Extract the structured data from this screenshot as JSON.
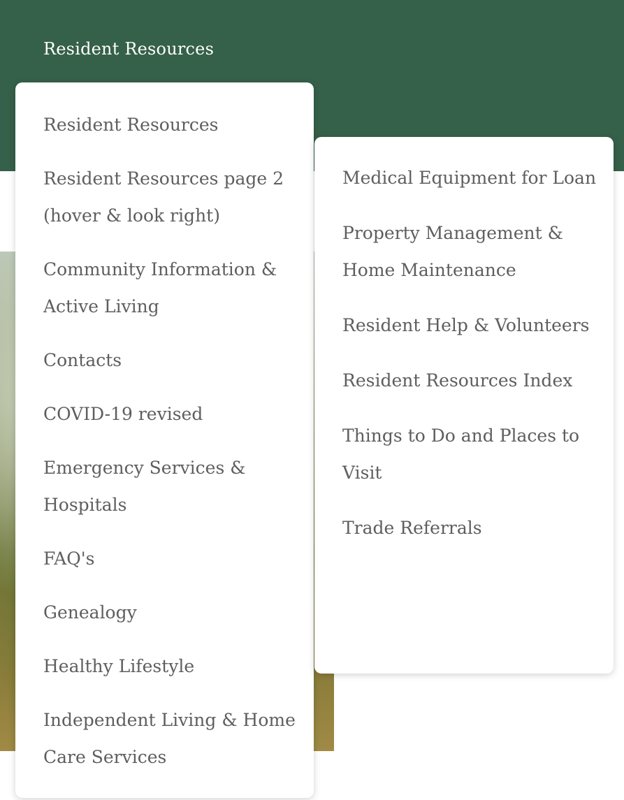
{
  "header": {
    "nav_title": "Resident Resources"
  },
  "colors": {
    "header_green": "#356049",
    "menu_text": "#5e5e5e",
    "menu_bg": "#ffffff"
  },
  "primary_menu": {
    "items": [
      {
        "label": "Resident Resources"
      },
      {
        "label": "Resident Resources page 2 (hover & look right)"
      },
      {
        "label": "Community Information & Active Living"
      },
      {
        "label": "Contacts"
      },
      {
        "label": "COVID-19 revised"
      },
      {
        "label": "Emergency Services & Hospitals"
      },
      {
        "label": "FAQ's"
      },
      {
        "label": "Genealogy"
      },
      {
        "label": "Healthy Lifestyle"
      },
      {
        "label": "Independent Living & Home Care Services"
      }
    ]
  },
  "submenu": {
    "items": [
      {
        "label": "Medical Equipment for Loan"
      },
      {
        "label": "Property Management & Home Maintenance"
      },
      {
        "label": "Resident Help & Volunteers"
      },
      {
        "label": "Resident Resources Index"
      },
      {
        "label": "Things to Do and Places to Visit"
      },
      {
        "label": "Trade Referrals"
      }
    ]
  }
}
